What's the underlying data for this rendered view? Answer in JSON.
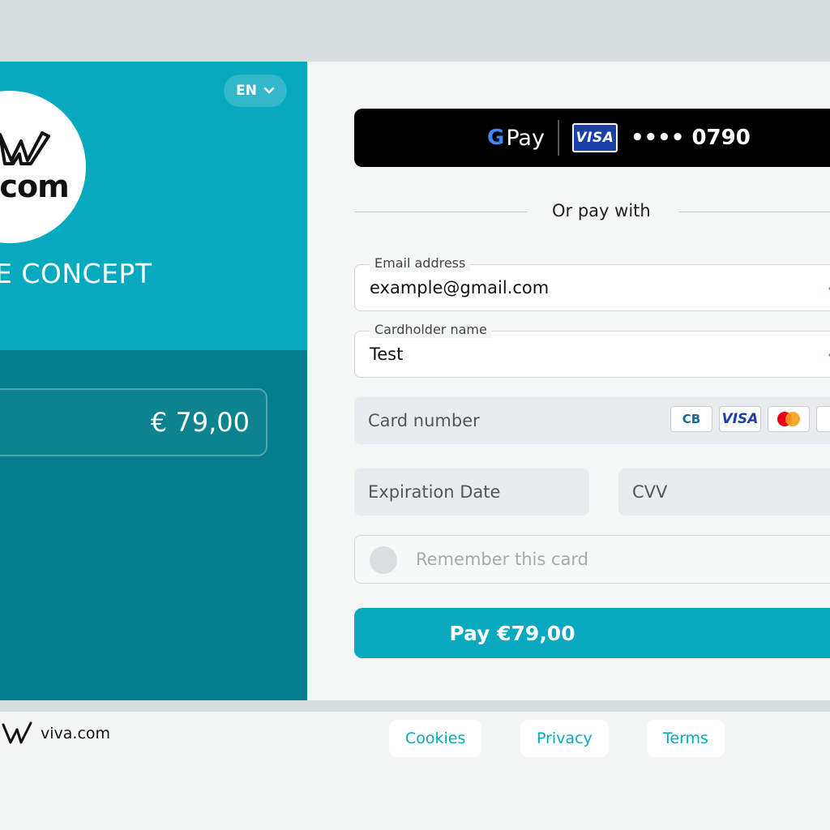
{
  "language": {
    "current": "EN"
  },
  "merchant": {
    "logo_text": ".com",
    "name": "E CONCEPT"
  },
  "order": {
    "amount": "€ 79,00"
  },
  "google_pay": {
    "g": "G",
    "pay": "Pay",
    "card_brand": "VISA",
    "card_masked": "•••• 0790"
  },
  "form": {
    "divider_text": "Or pay with",
    "email": {
      "label": "Email address",
      "value": "example@gmail.com"
    },
    "cardholder": {
      "label": "Cardholder name",
      "value": "Test"
    },
    "card_number": {
      "placeholder": "Card number",
      "brands": [
        "CB",
        "VISA",
        "mastercard",
        "···"
      ]
    },
    "expiration": {
      "placeholder": "Expiration Date"
    },
    "cvv": {
      "placeholder": "CVV"
    },
    "remember": {
      "label": "Remember this card"
    },
    "pay_button": {
      "label": "Pay €79,00"
    }
  },
  "footer": {
    "brand": "viva.com",
    "links": [
      "Cookies",
      "Privacy",
      "Terms"
    ]
  },
  "colors": {
    "accent": "#07a9bf",
    "accent_dark": "#047e8c",
    "checkmark": "#07a9bf"
  }
}
